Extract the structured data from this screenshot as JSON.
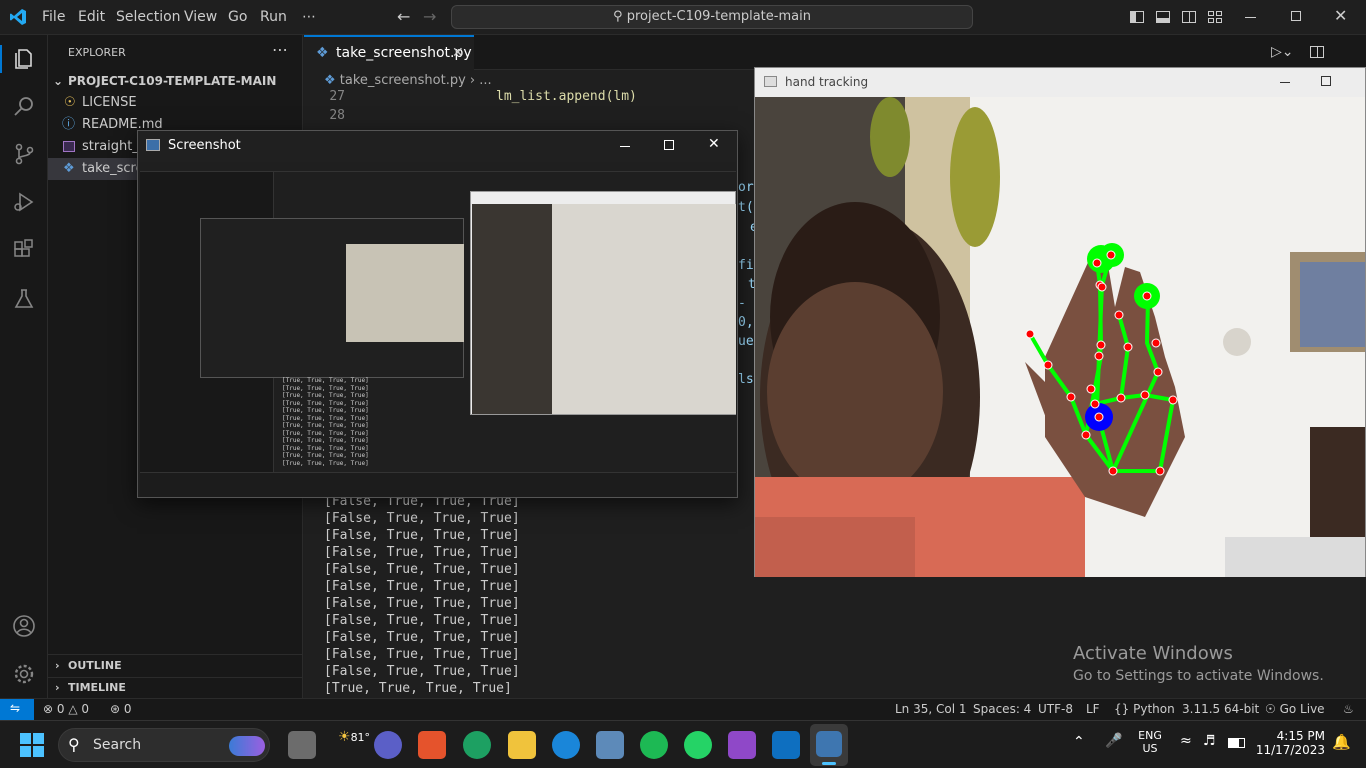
{
  "titlebar": {
    "menus": [
      "File",
      "Edit",
      "Selection",
      "View",
      "Go",
      "Run",
      "⋯"
    ],
    "search": "project-C109-template-main"
  },
  "sidebar": {
    "header": "EXPLORER",
    "project": "PROJECT-C109-TEMPLATE-MAIN",
    "files": [
      {
        "name": "LICENSE",
        "icon": "license-icon"
      },
      {
        "name": "README.md",
        "icon": "info-icon"
      },
      {
        "name": "straight_t",
        "icon": "image-icon"
      },
      {
        "name": "take_scree",
        "icon": "python-icon"
      }
    ],
    "outline": "OUTLINE",
    "timeline": "TIMELINE"
  },
  "editor": {
    "tab": "take_screenshot.py",
    "breadcrumb": "take_screenshot.py",
    "breadcrumb_more": "...",
    "lines": [
      {
        "num": "27",
        "code": "lm_list.append(lm)"
      },
      {
        "num": "28",
        "code": ""
      }
    ],
    "output": [
      "[False, True, True, True]",
      "[False, True, True, True]",
      "[False, True, True, True]",
      "[False, True, True, True]",
      "[False, True, True, True]",
      "[False, True, True, True]",
      "[False, True, True, True]",
      "[False, True, True, True]",
      "[False, True, True, True]",
      "[False, True, True, True]",
      "[False, True, True, True]",
      "[True, True, True, True]"
    ],
    "right_frag": [
      "or",
      "t(l",
      "e",
      "fin",
      "t",
      "-",
      "0,",
      "ue",
      "ls"
    ]
  },
  "screenshot_window": {
    "title": "Screenshot"
  },
  "hand_window": {
    "title": "hand tracking"
  },
  "watermark": {
    "line1": "Activate Windows",
    "line2": "Go to Settings to activate Windows."
  },
  "statusbar": {
    "errors": "0",
    "warnings": "0",
    "ports": "0",
    "position": "Ln 35, Col 1",
    "spaces": "Spaces: 4",
    "encoding": "UTF-8",
    "eol": "LF",
    "language": "Python",
    "interpreter": "3.11.5 64-bit",
    "golive": "Go Live"
  },
  "taskbar": {
    "search": "Search",
    "weather": "81°",
    "lang1": "ENG",
    "lang2": "US",
    "time": "4:15 PM",
    "date": "11/17/2023"
  },
  "colors": {
    "accent": "#0078d4",
    "landmark": "#ff0000",
    "bone": "#00ff00",
    "palm_dot": "#0000ff"
  }
}
